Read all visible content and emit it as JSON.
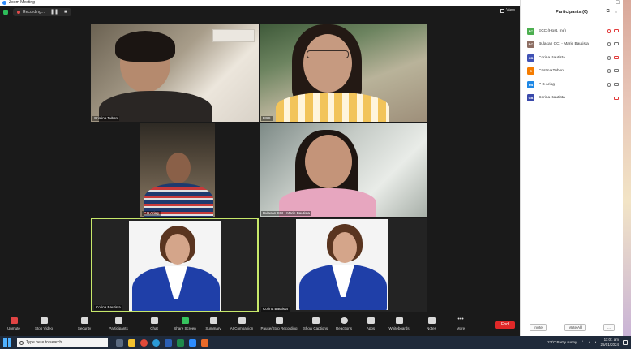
{
  "window": {
    "title": "Zoom Meeting"
  },
  "topbar": {
    "recording_label": "Recording...",
    "pause_glyph": "❚❚",
    "stop_glyph": "■",
    "view_label": "View"
  },
  "tiles": [
    {
      "id": "cristina",
      "name": "Cristina Tubon"
    },
    {
      "id": "ecc",
      "name": "ECC"
    },
    {
      "id": "pb",
      "name": "P B Ariag"
    },
    {
      "id": "bulacan",
      "name": "Bulacan CCI - Marie Bautista"
    },
    {
      "id": "corina1",
      "name": "Corina Bautista"
    },
    {
      "id": "corina2",
      "name": "Corina Bautista"
    }
  ],
  "toolbar": {
    "items": [
      {
        "label": "Unmute"
      },
      {
        "label": "Stop Video"
      },
      {
        "label": "Security"
      },
      {
        "label": "Participants",
        "count": "6"
      },
      {
        "label": "Chat"
      },
      {
        "label": "Share Screen"
      },
      {
        "label": "Summary"
      },
      {
        "label": "AI Companion"
      },
      {
        "label": "Pause/Stop Recording"
      },
      {
        "label": "Show Captions"
      },
      {
        "label": "Reactions"
      },
      {
        "label": "Apps"
      },
      {
        "label": "Whiteboards"
      },
      {
        "label": "Notes"
      },
      {
        "label": "More"
      }
    ],
    "end_label": "End"
  },
  "panel": {
    "title": "Participants (6)",
    "participants": [
      {
        "name": "ECC (Host, me)",
        "avatar_text": "EC",
        "avatar_color": "#4caf50",
        "mic": "muted",
        "cam": "off"
      },
      {
        "name": "Bulacan CCI - Marie Bautista",
        "avatar_text": "BC",
        "avatar_color": "#8d6e63",
        "mic": "on",
        "cam": "on"
      },
      {
        "name": "Corina Bautista",
        "avatar_text": "CB",
        "avatar_color": "#3f51b5",
        "mic": "on",
        "cam": "off"
      },
      {
        "name": "Cristina Tubon",
        "avatar_text": "C",
        "avatar_color": "#f57c00",
        "mic": "on",
        "cam": "on"
      },
      {
        "name": "P B Ariag",
        "avatar_text": "PB",
        "avatar_color": "#1e88e5",
        "mic": "on",
        "cam": "on"
      },
      {
        "name": "Corina Bautista",
        "avatar_text": "CB",
        "avatar_color": "#3949ab",
        "mic": "none",
        "cam": "off"
      }
    ],
    "footer": {
      "invite_label": "Invite",
      "mute_all_label": "Mute All",
      "more_label": "..."
    }
  },
  "taskbar": {
    "search_placeholder": "Type here to search",
    "weather": "23°C  Partly sunny",
    "time": "11:01 am",
    "date": "25/01/2024"
  }
}
